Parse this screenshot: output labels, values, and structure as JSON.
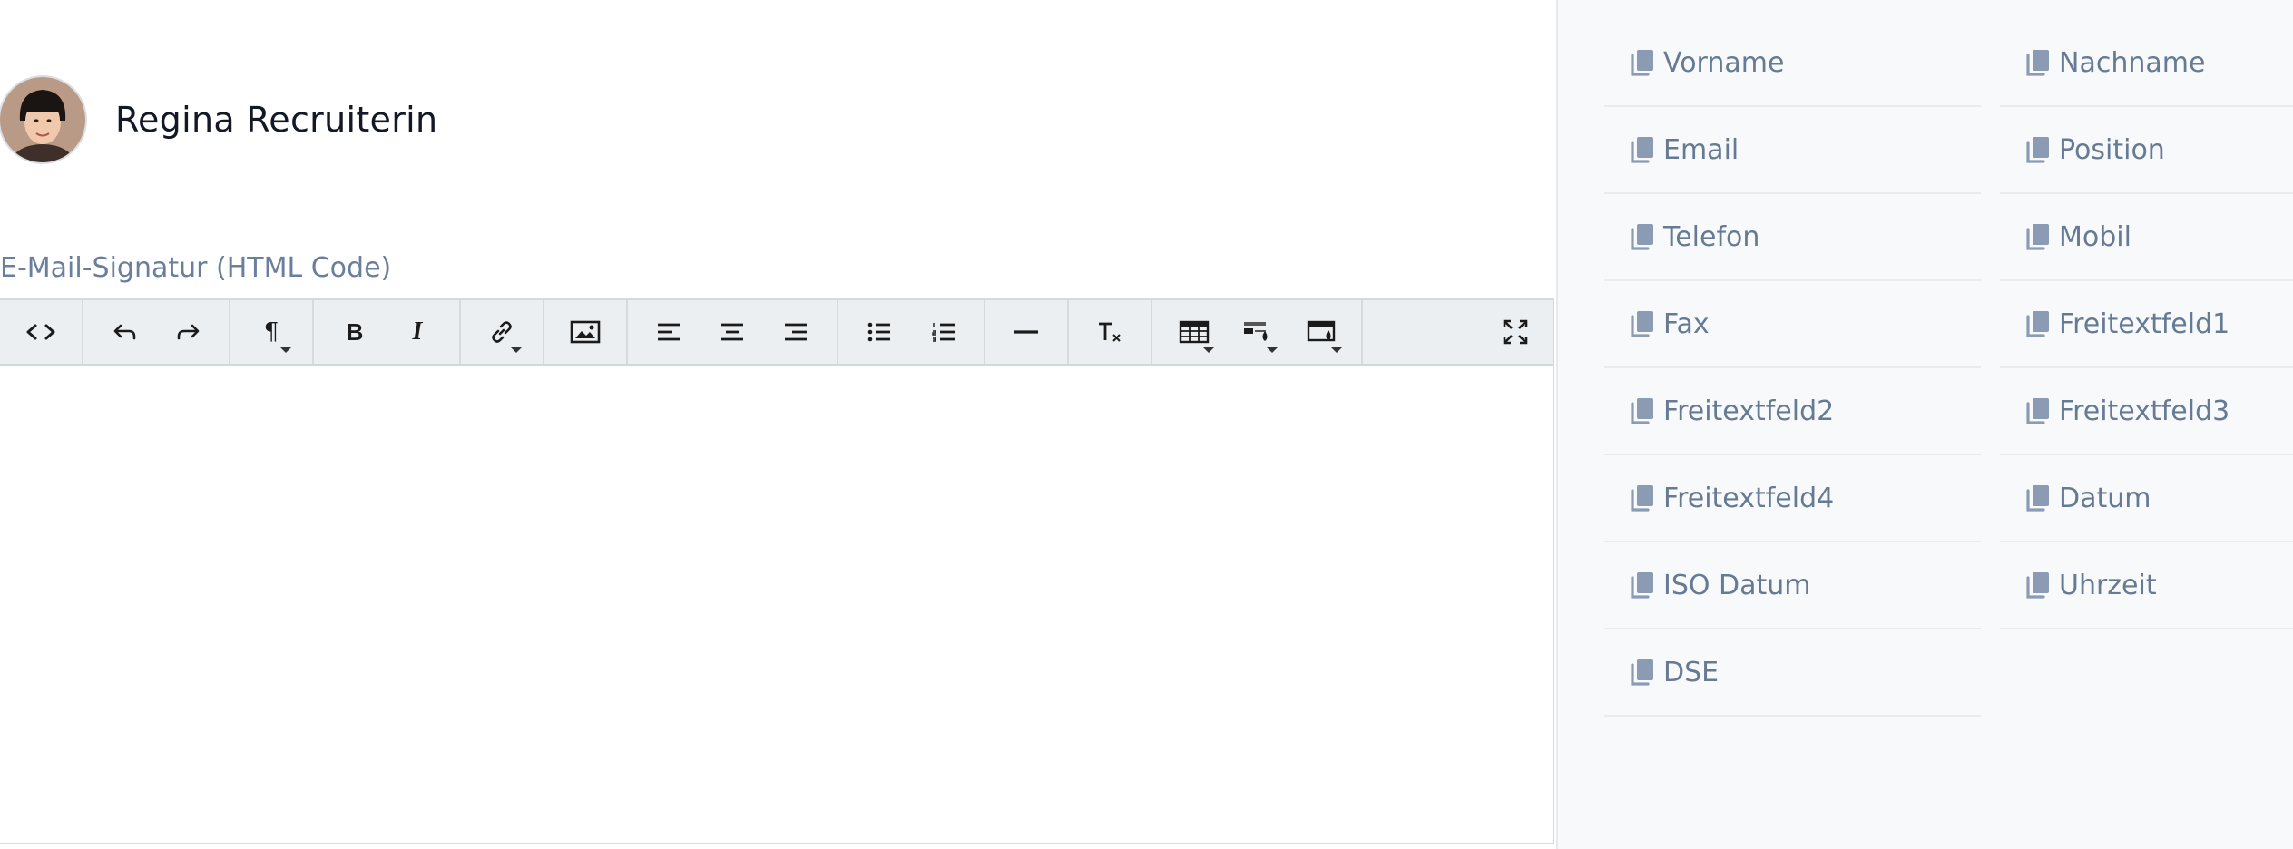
{
  "user": {
    "name": "Regina Recruiterin"
  },
  "signature_label": "E-Mail-Signatur (HTML Code)",
  "toolbar": {
    "items": [
      {
        "name": "source-code"
      },
      {
        "name": "undo"
      },
      {
        "name": "redo"
      },
      {
        "name": "paragraph-format"
      },
      {
        "name": "bold",
        "label": "B"
      },
      {
        "name": "italic",
        "label": "I"
      },
      {
        "name": "insert-link"
      },
      {
        "name": "insert-image"
      },
      {
        "name": "align-left"
      },
      {
        "name": "align-center"
      },
      {
        "name": "align-right"
      },
      {
        "name": "unordered-list"
      },
      {
        "name": "ordered-list"
      },
      {
        "name": "horizontal-line"
      },
      {
        "name": "clear-formatting"
      },
      {
        "name": "insert-table"
      },
      {
        "name": "table-cell-style"
      },
      {
        "name": "background-color"
      },
      {
        "name": "fullscreen"
      }
    ],
    "paragraph_symbol": "¶"
  },
  "placeholders": {
    "left": [
      "Vorname",
      "Email",
      "Telefon",
      "Fax",
      "Freitextfeld2",
      "Freitextfeld4",
      "ISO Datum",
      "DSE"
    ],
    "right": [
      "Nachname",
      "Position",
      "Mobil",
      "Freitextfeld1",
      "Freitextfeld3",
      "Datum",
      "Uhrzeit"
    ]
  },
  "colors": {
    "accent_border": "#c9dcd8",
    "placeholder_text": "#667a94",
    "panel_bg": "#f7f9fb"
  }
}
